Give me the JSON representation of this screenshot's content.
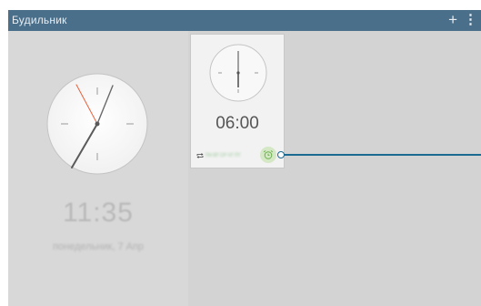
{
  "app": {
    "title": "Будильник"
  },
  "toolbar": {
    "add_glyph": "+",
    "more_glyph": "⋮"
  },
  "world_clock": {
    "time": "11:35",
    "date": "понедельник, 7 Апр"
  },
  "alarm": {
    "time": "06:00",
    "days": "ПН ВТ СР ЧТ ПТ",
    "active": true
  },
  "colors": {
    "title_bar": "#4a6f8a",
    "background": "#d3d3d3",
    "card": "#f2f2f2",
    "alarm_icon": "#6ab04c",
    "second_hand": "#e8603c",
    "callout": "#1b6a92"
  }
}
